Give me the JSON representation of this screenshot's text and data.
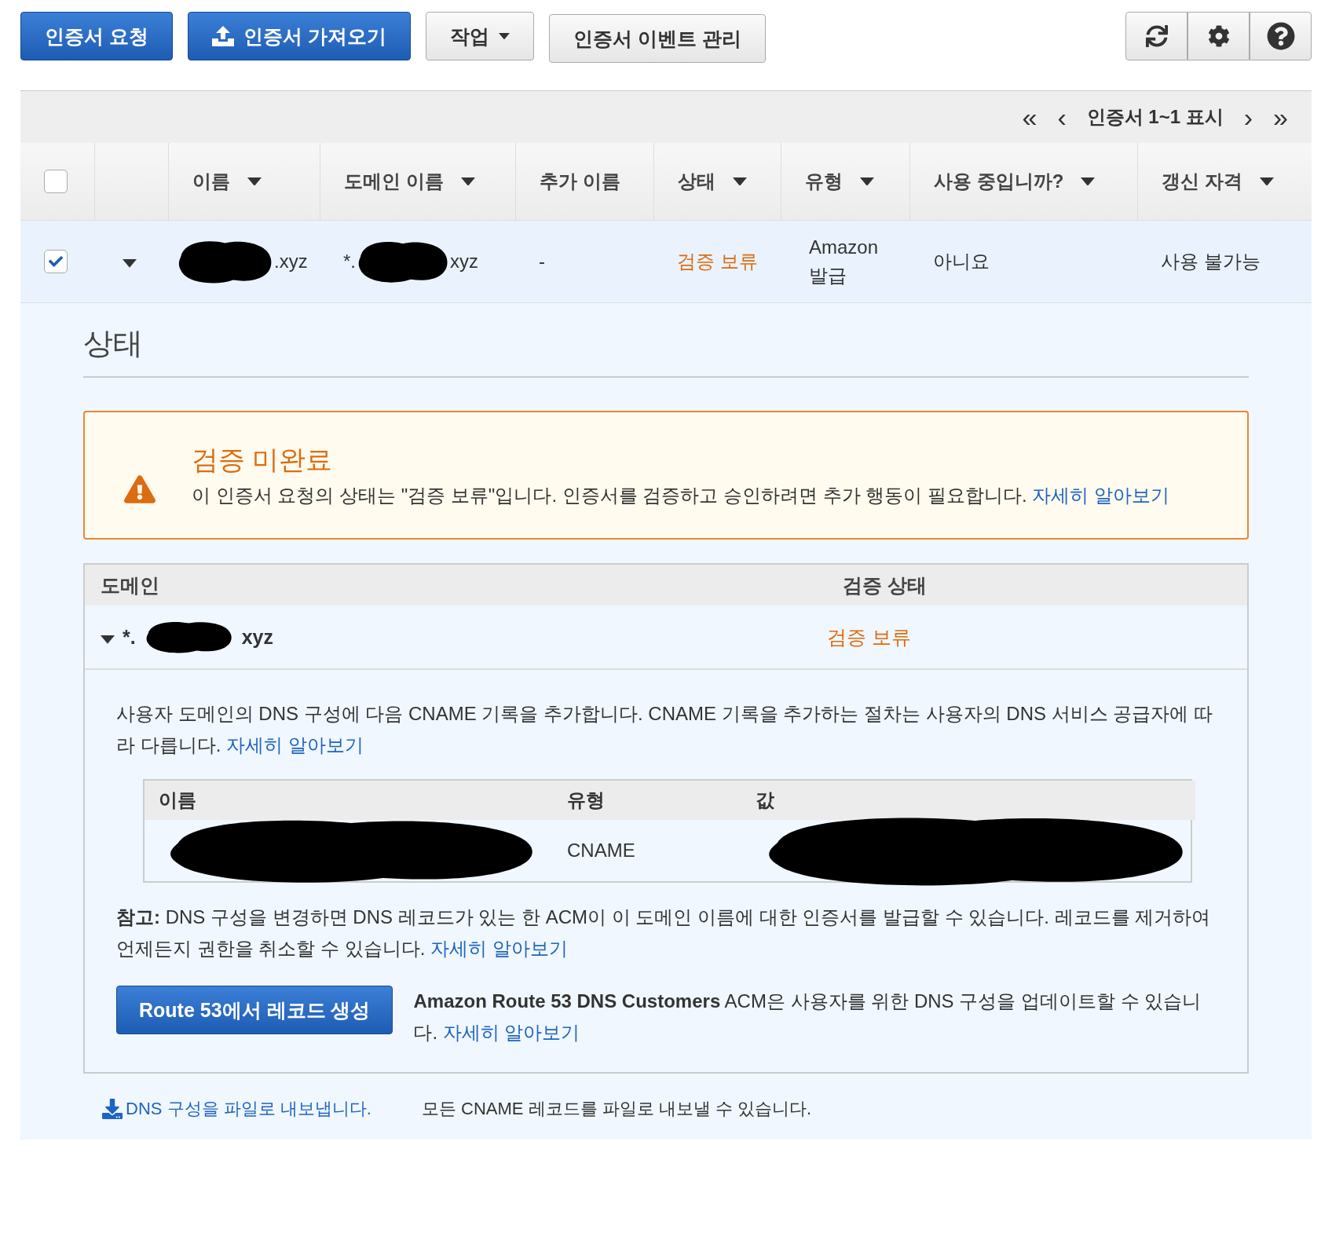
{
  "toolbar": {
    "buttons": [
      {
        "label": "인증서 요청",
        "kind": "primary"
      },
      {
        "label": "인증서 가져오기",
        "kind": "upload"
      },
      {
        "label": "작업",
        "kind": "dropdown"
      },
      {
        "label": "인증서 이벤트 관리",
        "kind": "default"
      }
    ]
  },
  "pager": {
    "first": "«",
    "prev": "‹",
    "text": "인증서 1~1 표시",
    "next": "›",
    "last": "»"
  },
  "table": {
    "select_all": {
      "checked": false
    },
    "columns": [
      {
        "label": "이름",
        "sortable": true
      },
      {
        "label": "도메인 이름",
        "sortable": true
      },
      {
        "label": "추가 이름",
        "sortable": false
      },
      {
        "label": "상태",
        "sortable": true
      },
      {
        "label": "유형",
        "sortable": true
      },
      {
        "label": "사용 중입니까?",
        "sortable": true
      },
      {
        "label": "갱신 자격",
        "sortable": true
      }
    ],
    "rows": [
      {
        "checked": true,
        "expanded": true,
        "name": {
          "end": ".xyz"
        },
        "domain": {
          "start": "*.",
          "end": "xyz"
        },
        "additional": "-",
        "status": "검증 보류",
        "type": "Amazon 발급",
        "in_use": "아니요",
        "renewal": "사용 불가능"
      }
    ]
  },
  "detail": {
    "heading": "상태",
    "alert": {
      "title": "검증 미완료",
      "message": "이 인증서 요청의 상태는 \"검증 보류\"입니다. 인증서를 검증하고 승인하려면 추가 행동이 필요합니다.",
      "link": "자세히 알아보기"
    },
    "domains": {
      "columns": [
        "도메인",
        "검증 상태"
      ],
      "rows": [
        {
          "expanded": true,
          "domain": {
            "start": "*.",
            "end": "xyz"
          },
          "status": "검증 보류",
          "instructions": "사용자 도메인의 DNS 구성에 다음 CNAME 기록을 추가합니다. CNAME 기록을 추가하는 절차는 사용자의 DNS 서비스 공급자에 따라 다릅니다.",
          "instructions_link": "자세히 알아보기",
          "records": {
            "columns": [
              "이름",
              "유형",
              "값"
            ],
            "rows": [
              {
                "type": "CNAME"
              }
            ]
          },
          "note": "**참고:** DNS 구성을 변경하면 DNS 레코드가 있는 한 ACM이 이 도메인 이름에 대한 인증서를 발급할 수 있습니다. 레코드를 제거하여 언제든지 권한을 취소할 수 있습니다.",
          "note_link": "자세히 알아보기",
          "route53_button": "Route 53에서 레코드 생성",
          "route53_text": "**Amazon Route 53 DNS Customers** ACM은 사용자를 위한 DNS 구성을 업데이트할 수 있습니다.",
          "route53_link": "자세히 알아보기"
        }
      ]
    }
  },
  "export": {
    "link": "DNS 구성을 파일로 내보냅니다.",
    "text": "모든 CNAME 레코드를 파일로 내보낼 수 있습니다."
  }
}
